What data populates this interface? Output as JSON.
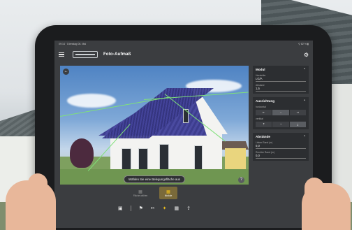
{
  "statusbar": {
    "left": "09:14 · Dienstag 06. Mai",
    "right": "⚲ 82 % ▮"
  },
  "appbar": {
    "title": "Foto-Aufmaß"
  },
  "photo": {
    "hint": "Wählen Sie eine Belegungsfläche aus",
    "back_glyph": "←",
    "help_glyph": "?"
  },
  "panel": {
    "modul": {
      "title": "Modul",
      "f1_label": "Hersteller",
      "f1_value": "LG/A",
      "f2_label": "Abstand",
      "f2_value": "1,5"
    },
    "ausrichtung": {
      "title": "Ausrichtung",
      "f1_label": "horizontal",
      "f2_label": "vertikal",
      "h_opts": [
        "⇤",
        "⇔",
        "⇥"
      ],
      "v_opts": [
        "⤒",
        "↕",
        "⤓"
      ]
    },
    "abstaende": {
      "title": "Abstände",
      "f1_label": "Linker Rand (m)",
      "f1_value": "0,0",
      "f2_label": "Rechter Rand (m)",
      "f2_value": "0,0"
    }
  },
  "modes": [
    {
      "label": "Fläche wählen",
      "icon": "▦"
    },
    {
      "label": "Module",
      "icon": "▦"
    }
  ],
  "toolbar_icons": [
    "▣",
    "⚑",
    "✂",
    "✦",
    "▦",
    "⇪"
  ],
  "colors": {
    "accent": "#f2c21a",
    "screen": "#3b3d40",
    "card": "#2c2e31"
  }
}
